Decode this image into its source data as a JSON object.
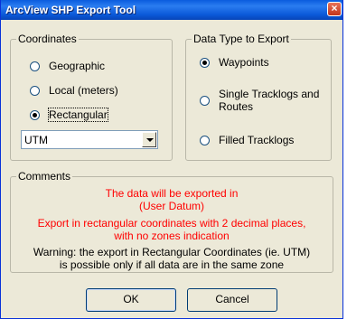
{
  "window": {
    "title": "ArcView SHP Export Tool",
    "close_glyph": "×"
  },
  "coordinates": {
    "legend": "Coordinates",
    "options": [
      {
        "label": "Geographic",
        "checked": false
      },
      {
        "label": "Local (meters)",
        "checked": false
      },
      {
        "label": "Rectangular",
        "checked": true
      }
    ],
    "combo_value": "UTM"
  },
  "data_type": {
    "legend": "Data Type to Export",
    "options": [
      {
        "label": "Waypoints",
        "checked": true
      },
      {
        "label_line1": "Single Tracklogs and",
        "label_line2": "Routes",
        "checked": false
      },
      {
        "label": "Filled Tracklogs",
        "checked": false
      }
    ]
  },
  "comments": {
    "legend": "Comments",
    "line1": "The data will be exported in",
    "line2": "(User Datum)",
    "line3": "Export in rectangular coordinates with 2 decimal places,",
    "line4": "with no zones indication",
    "line5": "Warning: the export in Rectangular Coordinates (ie. UTM)",
    "line6": "is possible only if all data are in the same zone"
  },
  "buttons": {
    "ok": "OK",
    "cancel": "Cancel"
  },
  "colors": {
    "titlebar": "#0a5bde",
    "dialog_bg": "#ece9d8",
    "highlight_text": "#ff0000"
  }
}
